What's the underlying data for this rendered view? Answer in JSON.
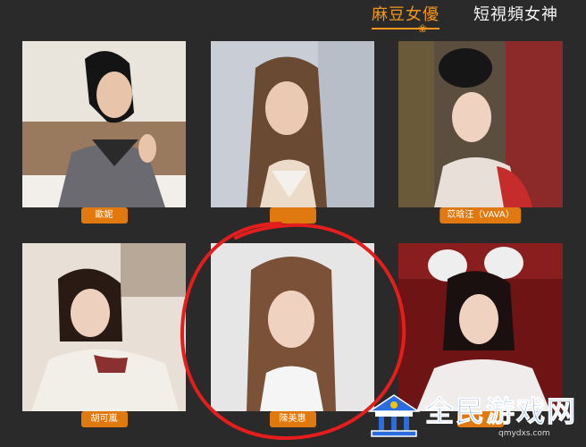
{
  "tabs": {
    "active_label": "麻豆女優",
    "inactive_label": "短視頻女神"
  },
  "actresses": [
    {
      "name": "歐妮"
    },
    {
      "name": ""
    },
    {
      "name": "苡晗汪（VAVA）"
    },
    {
      "name": "胡可嵐"
    },
    {
      "name": "陳美惠"
    },
    {
      "name": ""
    }
  ],
  "annotation": {
    "color": "#e41d1d"
  },
  "watermark": {
    "text": "全民游戏网",
    "url": "qmydxs.com"
  },
  "colors": {
    "background": "#2a2a2a",
    "accent": "#f0961e",
    "badge": "#e07a10"
  }
}
